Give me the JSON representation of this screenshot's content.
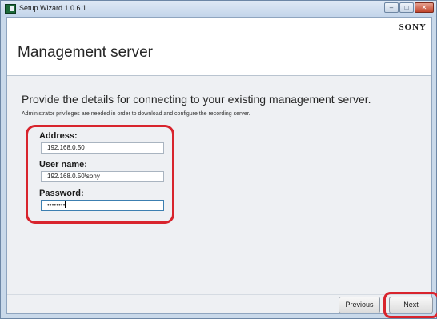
{
  "window": {
    "title": "Setup Wizard 1.0.6.1",
    "app_icon": "setup-wizard-app-icon",
    "controls": {
      "minimize": "–",
      "maximize": "□",
      "close": "✕"
    }
  },
  "header": {
    "brand": "SONY",
    "title": "Management server"
  },
  "main": {
    "heading": "Provide the details for connecting to your existing management server.",
    "note": "Administrator privileges are needed in order to download and configure the recording server.",
    "fields": {
      "address": {
        "label": "Address:",
        "value": "192.168.0.50"
      },
      "username": {
        "label": "User name:",
        "value": "192.168.0.50\\sony"
      },
      "password": {
        "label": "Password:",
        "value": "••••••••"
      }
    }
  },
  "footer": {
    "previous_label": "Previous",
    "next_label": "Next"
  },
  "colors": {
    "highlight": "#d8242d",
    "content_bg": "#eef0f3",
    "frame": "#c9d9ea"
  }
}
